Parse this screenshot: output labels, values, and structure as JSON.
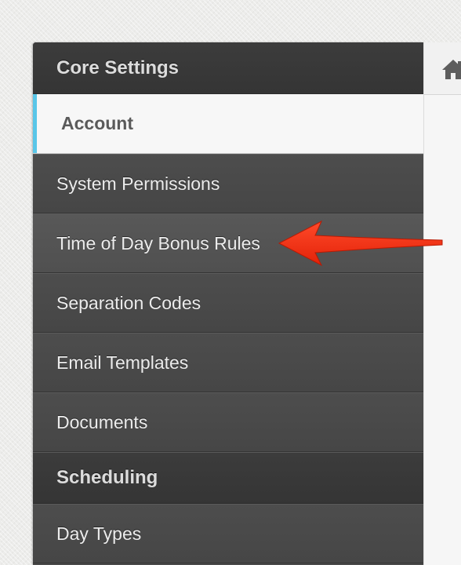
{
  "sidebar": {
    "core_header": "Core Settings",
    "items": [
      {
        "label": "Account"
      },
      {
        "label": "System Permissions"
      },
      {
        "label": "Time of Day Bonus Rules"
      },
      {
        "label": "Separation Codes"
      },
      {
        "label": "Email Templates"
      },
      {
        "label": "Documents"
      }
    ],
    "scheduling_header": "Scheduling",
    "scheduling_items": [
      {
        "label": "Day Types"
      }
    ]
  },
  "colors": {
    "active_indicator": "#59c6e8",
    "annotation_arrow": "#ee2a10"
  },
  "icons": {
    "content_bar": "home-icon",
    "annotation": "red-arrow-icon"
  }
}
